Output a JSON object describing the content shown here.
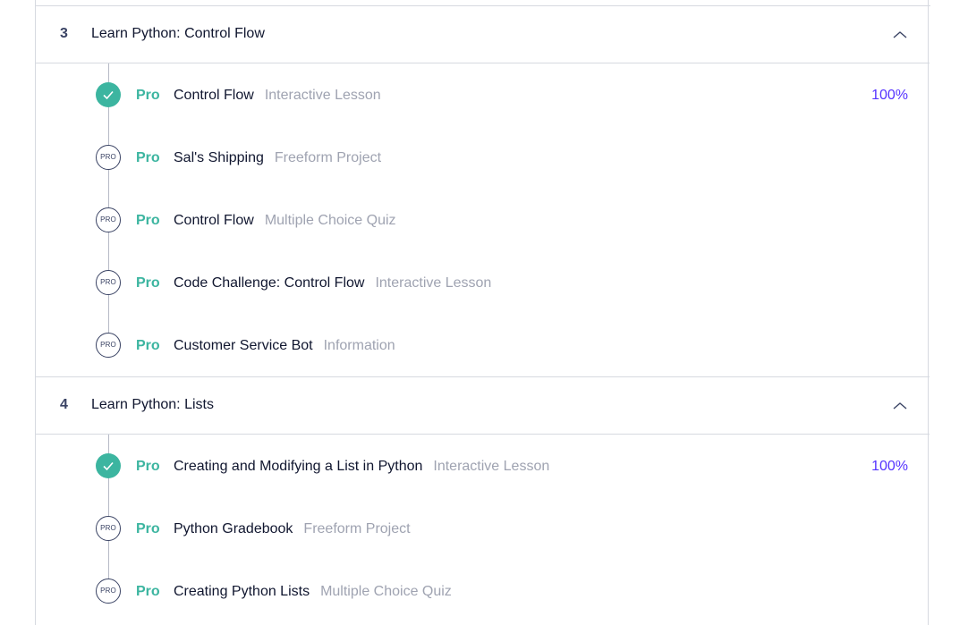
{
  "colors": {
    "accent_green": "#3cb5a0",
    "progress_purple": "#5533ff",
    "muted_text": "#9fa3b1",
    "border": "#d6d9e0"
  },
  "modules": [
    {
      "number": "3",
      "title": "Learn Python: Control Flow",
      "expanded": true,
      "items": [
        {
          "tag": "Pro",
          "title": "Control Flow",
          "type": "Interactive Lesson",
          "completed": true,
          "progress": "100%"
        },
        {
          "tag": "Pro",
          "title": "Sal's Shipping",
          "type": "Freeform Project",
          "completed": false,
          "badge": "PRO"
        },
        {
          "tag": "Pro",
          "title": "Control Flow",
          "type": "Multiple Choice Quiz",
          "completed": false,
          "badge": "PRO"
        },
        {
          "tag": "Pro",
          "title": "Code Challenge: Control Flow",
          "type": "Interactive Lesson",
          "completed": false,
          "badge": "PRO"
        },
        {
          "tag": "Pro",
          "title": "Customer Service Bot",
          "type": "Information",
          "completed": false,
          "badge": "PRO"
        }
      ]
    },
    {
      "number": "4",
      "title": "Learn Python: Lists",
      "expanded": true,
      "items": [
        {
          "tag": "Pro",
          "title": "Creating and Modifying a List in Python",
          "type": "Interactive Lesson",
          "completed": true,
          "progress": "100%"
        },
        {
          "tag": "Pro",
          "title": "Python Gradebook",
          "type": "Freeform Project",
          "completed": false,
          "badge": "PRO"
        },
        {
          "tag": "Pro",
          "title": "Creating Python Lists",
          "type": "Multiple Choice Quiz",
          "completed": false,
          "badge": "PRO"
        }
      ]
    }
  ]
}
